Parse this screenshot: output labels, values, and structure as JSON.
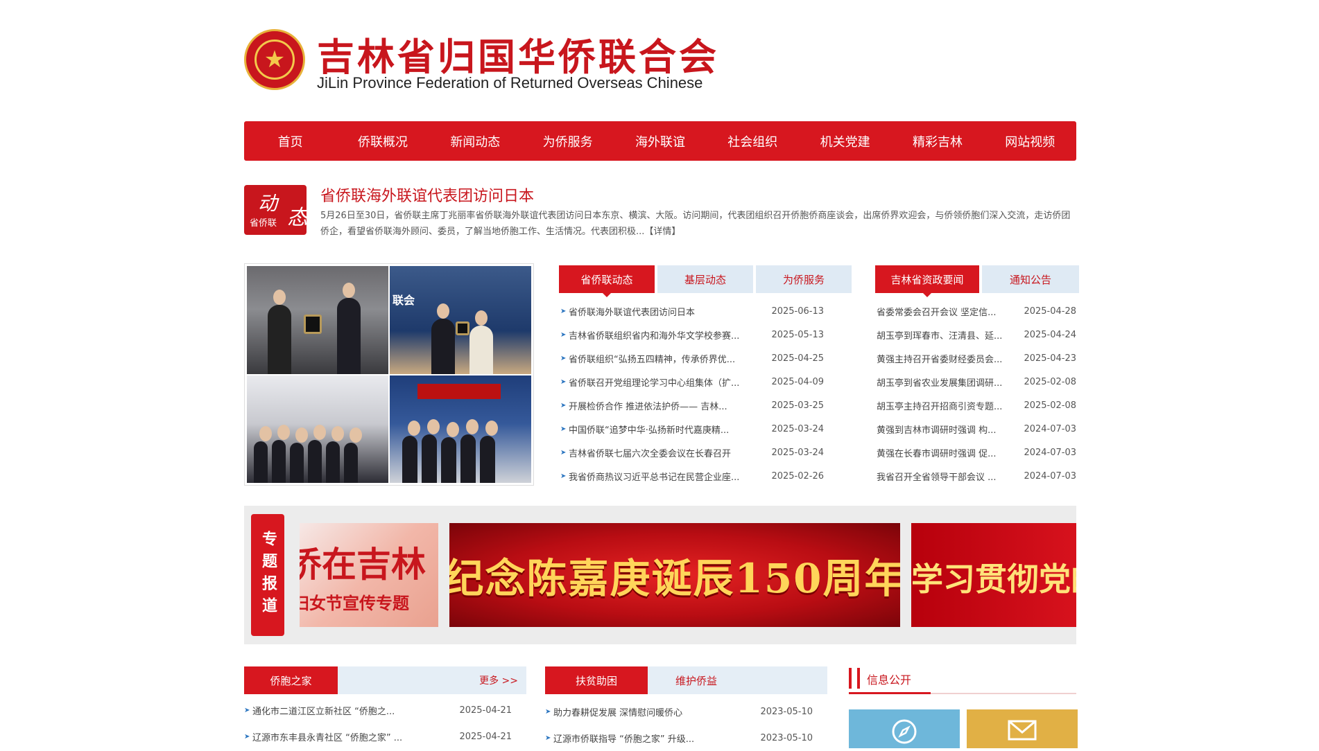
{
  "site": {
    "title_cn": "吉林省归国华侨联合会",
    "title_en": "JiLin Province Federation of Returned Overseas Chinese"
  },
  "nav": [
    "首页",
    "侨联概况",
    "新闻动态",
    "为侨服务",
    "海外联谊",
    "社会组织",
    "机关党建",
    "精彩吉林",
    "网站视频"
  ],
  "headline": {
    "badge_1": "动",
    "badge_2": "态",
    "badge_3": "省侨联",
    "title": "省侨联海外联谊代表团访问日本",
    "summary": "5月26日至30日，省侨联主席丁兆丽率省侨联海外联谊代表团访问日本东京、横滨、大阪。访问期间，代表团组织召开侨胞侨商座谈会，出席侨界欢迎会，与侨领侨胞们深入交流，走访侨团侨企，看望省侨联海外顾问、委员，了解当地侨胞工作、生活情况。代表团积极...",
    "more": "【详情】"
  },
  "photos": {
    "screen_text": "联会"
  },
  "news_tabs": [
    "省侨联动态",
    "基层动态",
    "为侨服务"
  ],
  "news_list": [
    {
      "title": "省侨联海外联谊代表团访问日本",
      "date": "2025-06-13"
    },
    {
      "title": "吉林省侨联组织省内和海外华文学校参赛...",
      "date": "2025-05-13"
    },
    {
      "title": "省侨联组织“弘扬五四精神，传承侨界优...",
      "date": "2025-04-25"
    },
    {
      "title": "省侨联召开党组理论学习中心组集体（扩...",
      "date": "2025-04-09"
    },
    {
      "title": "开展检侨合作 推进依法护侨—— 吉林...",
      "date": "2025-03-25"
    },
    {
      "title": "中国侨联“追梦中华·弘扬新时代嘉庚精...",
      "date": "2025-03-24"
    },
    {
      "title": "吉林省侨联七届六次全委会议在长春召开",
      "date": "2025-03-24"
    },
    {
      "title": "我省侨商热议习近平总书记在民营企业座...",
      "date": "2025-02-26"
    }
  ],
  "gov_tabs": [
    "吉林省资政要闻",
    "通知公告"
  ],
  "gov_list": [
    {
      "title": "省委常委会召开会议 坚定信...",
      "date": "2025-04-28"
    },
    {
      "title": "胡玉亭到珲春市、汪清县、延...",
      "date": "2025-04-24"
    },
    {
      "title": "黄强主持召开省委财经委员会...",
      "date": "2025-04-23"
    },
    {
      "title": "胡玉亭到省农业发展集团调研...",
      "date": "2025-02-08"
    },
    {
      "title": "胡玉亭主持召开招商引资专题...",
      "date": "2025-02-08"
    },
    {
      "title": "黄强到吉林市调研时强调 构...",
      "date": "2024-07-03"
    },
    {
      "title": "黄强在长春市调研时强调 促...",
      "date": "2024-07-03"
    },
    {
      "title": "我省召开全省领导干部会议 ...",
      "date": "2024-07-03"
    }
  ],
  "special": {
    "tag": "专题报道",
    "banner1_line1": "侨在吉林",
    "banner1_line2": "妇女节宣传专题",
    "banner2": "纪念陈嘉庚诞辰150周年",
    "banner3": "学习贯彻党的"
  },
  "home": {
    "tab": "侨胞之家",
    "more": "更多 >>",
    "items": [
      {
        "title": "通化市二道江区立新社区 “侨胞之...",
        "date": "2025-04-21"
      },
      {
        "title": "辽源市东丰县永青社区 “侨胞之家” ...",
        "date": "2025-04-21"
      }
    ]
  },
  "aid": {
    "tabs": [
      "扶贫助困",
      "维护侨益"
    ],
    "items": [
      {
        "title": "助力春耕促发展 深情慰问暖侨心",
        "date": "2023-05-10"
      },
      {
        "title": "辽源市侨联指导 “侨胞之家” 升级...",
        "date": "2023-05-10"
      }
    ]
  },
  "info": {
    "title": "信息公开"
  },
  "colors": {
    "brand_red": "#d7171f",
    "tab_blue": "#dfeaf4",
    "tile_blue": "#6eb7da",
    "tile_gold": "#e1b045"
  },
  "icons": {
    "tile1": "compass-icon",
    "tile2": "envelope-icon"
  }
}
